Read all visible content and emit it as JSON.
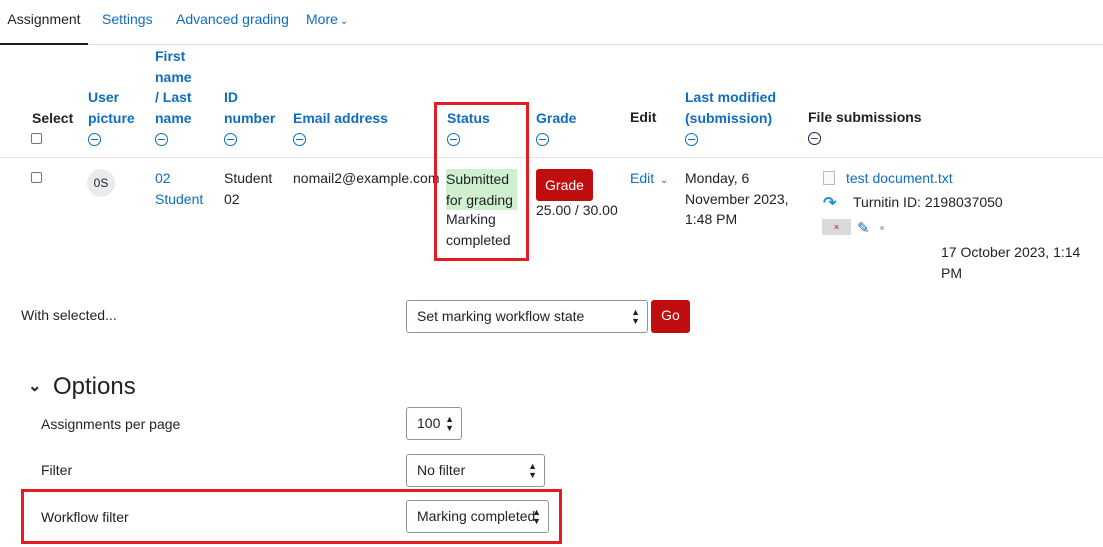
{
  "tabs": [
    "Assignment",
    "Settings",
    "Advanced grading",
    "More"
  ],
  "headers": {
    "select": "Select",
    "user_picture_1": "User",
    "user_picture_2": "picture",
    "name_1": "First",
    "name_2": "name",
    "name_3": "/ Last",
    "name_4": "name",
    "id_1": "ID",
    "id_2": "number",
    "email": "Email address",
    "status": "Status",
    "grade": "Grade",
    "edit": "Edit",
    "lastmod_1": "Last modified",
    "lastmod_2": "(submission)",
    "files": "File submissions"
  },
  "row": {
    "initials": "0S",
    "name_1": "02",
    "name_2": "Student",
    "id_1": "Student",
    "id_2": "02",
    "email": "nomail2@example.com",
    "status_1": "Submitted",
    "status_2": "for grading",
    "status_3": "Marking",
    "status_4": "completed",
    "grade_button": "Grade",
    "grade_value": "25.00 / 30.00",
    "edit": "Edit",
    "lastmod_1": "Monday, 6",
    "lastmod_2": "November 2023,",
    "lastmod_3": "1:48 PM",
    "file_name": "test document.txt",
    "turnitin": "Turnitin ID: 2198037050",
    "file_date": "17 October 2023, 1:14 PM"
  },
  "bulk": {
    "label": "With selected...",
    "select_value": "Set marking workflow state",
    "go": "Go"
  },
  "options": {
    "heading": "Options",
    "per_page_label": "Assignments per page",
    "per_page_value": "100",
    "filter_label": "Filter",
    "filter_value": "No filter",
    "workflow_label": "Workflow filter",
    "workflow_value": "Marking completed"
  },
  "colors": {
    "link": "#0f6cbf",
    "danger": "#c00d10",
    "highlight_box": "#e31b23",
    "submitted_bg": "#cfefcf"
  }
}
